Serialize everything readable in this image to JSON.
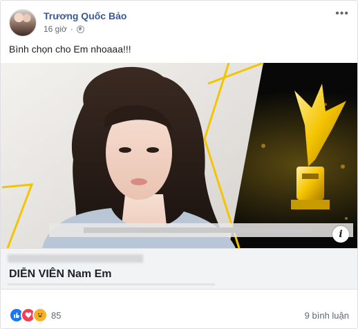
{
  "post": {
    "author": "Trương Quốc Bảo",
    "time": "16 giờ",
    "privacy_icon": "globe-icon",
    "more_label": "•••",
    "message": "Bình chọn cho Em nhoaaa!!!"
  },
  "link_preview": {
    "title": "DIỄN VIÊN Nam Em",
    "info_label": "i"
  },
  "reactions": {
    "icons": [
      "like-icon",
      "love-icon",
      "haha-icon"
    ],
    "count": "85"
  },
  "comments_label": "9 bình luận",
  "colors": {
    "author": "#385898",
    "banner_bg": "#0b0c0c",
    "gold": "#f5c400"
  }
}
